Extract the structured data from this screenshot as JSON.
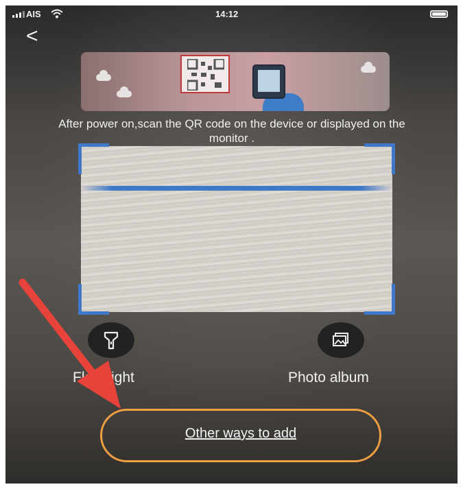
{
  "status_bar": {
    "carrier": "AIS",
    "time": "14:12",
    "icons": [
      "signal-icon",
      "wifi-icon",
      "battery-icon"
    ]
  },
  "header": {
    "back_symbol": "<",
    "back_icon": "chevron-left-icon"
  },
  "banner": {
    "icon": "qr-scan-illustration"
  },
  "instruction": "After power on,scan the QR code on the device or displayed on the monitor .",
  "scanner": {
    "accent_color": "#3f78c9"
  },
  "tools": {
    "flashlight": {
      "label": "Flashlight",
      "icon": "flashlight-icon"
    },
    "photo_album": {
      "label": "Photo album",
      "icon": "photo-album-icon"
    }
  },
  "other_ways": {
    "label": "Other ways to add",
    "highlight_color": "#f0a040"
  },
  "annotation": {
    "arrow_color": "#e8433b",
    "arrow_icon": "red-arrow"
  }
}
